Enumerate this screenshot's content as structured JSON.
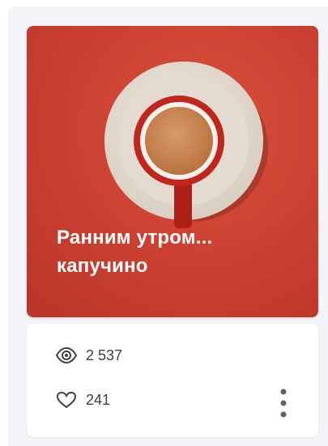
{
  "card": {
    "title_line1": "Ранним утром...",
    "title_line2": "капучино",
    "image_icon": "coffee-cup-icon",
    "colors": {
      "background": "#cf4333",
      "title_text": "#ffffff"
    }
  },
  "stats": {
    "views": "2 537",
    "likes": "241",
    "views_icon": "eye-icon",
    "likes_icon": "heart-icon",
    "more_icon": "vertical-dots-icon",
    "text_color": "#3c4149"
  }
}
